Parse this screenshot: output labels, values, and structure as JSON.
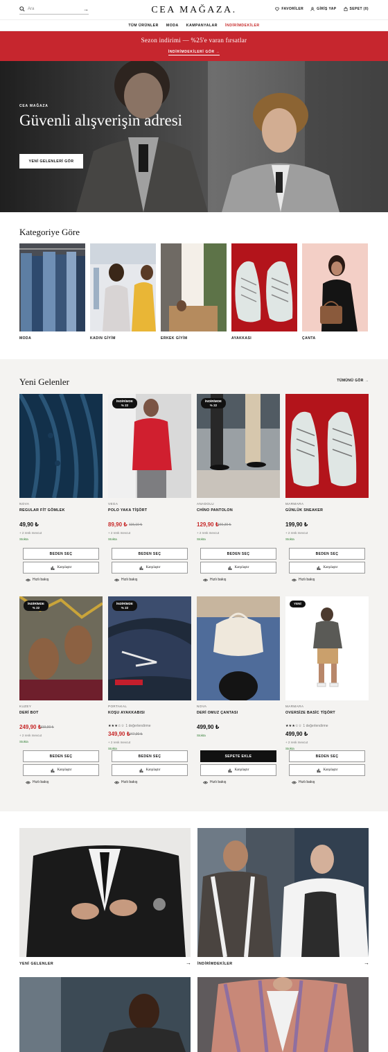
{
  "header": {
    "search_placeholder": "Ara",
    "logo": "CEA MAĞAZA.",
    "favorites": "FAVORİLER",
    "login": "GİRİŞ YAP",
    "cart": "SEPET (0)"
  },
  "nav": [
    "TÜM ÜRÜNLER",
    "MODA",
    "KAMPANYALAR",
    "İNDİRİMDEKİLER"
  ],
  "banner": {
    "text": "Sezon indirimi — %25'e varan fırsatlar",
    "link": "İNDİRİMDEKİLERİ GÖR →"
  },
  "hero": {
    "eyebrow": "CEA MAĞAZA",
    "title": "Güvenli alışverişin adresi",
    "button": "YENİ GELENLERİ GÖR"
  },
  "categories": {
    "title": "Kategoriye Göre",
    "items": [
      "MODA",
      "KADIN GİYİM",
      "ERKEK GİYİM",
      "AYAKKASI",
      "ÇANTA"
    ]
  },
  "new_arrivals": {
    "title": "Yeni Gelenler",
    "see_all": "TÜMÜNÜ GÖR →",
    "size_button": "BEDEN SEÇ",
    "add_to_cart": "SEPETE EKLE",
    "compare": "Karşılaştır",
    "quick_view": "Hızlı bakış",
    "products": [
      {
        "brand": "NOVA",
        "name": "REGULAR FİT GÖMLEK",
        "price": "49,90 ₺",
        "old_price": "",
        "colors": "+ 2 renk mevcut",
        "stock": "Stokta",
        "badge": "",
        "rating_text": ""
      },
      {
        "brand": "VEGA",
        "name": "POLO YAKA TİŞÖRT",
        "price": "89,90 ₺",
        "old_price": "115,10 ₺",
        "colors": "+ 2 renk mevcut",
        "stock": "Stokta",
        "badge": "İNDİRİMDE\n% 22",
        "rating_text": ""
      },
      {
        "brand": "ANADOLU",
        "name": "CHİNO PANTOLON",
        "price": "129,90 ₺",
        "old_price": "166,30 ₺",
        "colors": "+ 2 renk mevcut",
        "stock": "Stokta",
        "badge": "İNDİRİMDE\n% 22",
        "rating_text": ""
      },
      {
        "brand": "MARMARA",
        "name": "GÜNLÜK SNEAKER",
        "price": "199,90 ₺",
        "old_price": "",
        "colors": "+ 2 renk mevcut",
        "stock": "Stokta",
        "badge": "",
        "rating_text": ""
      },
      {
        "brand": "KUZEY",
        "name": "DERİ BOT",
        "price": "249,90 ₺",
        "old_price": "319,90 ₺",
        "colors": "+ 2 renk mevcut",
        "stock": "Stokta",
        "badge": "İNDİRİMDE\n% 22",
        "rating_text": ""
      },
      {
        "brand": "PORTAKAL",
        "name": "KOŞU AYAKKABISI",
        "price": "349,90 ₺",
        "old_price": "447,90 ₺",
        "colors": "+ 2 renk mevcut",
        "stock": "Stokta",
        "badge": "İNDİRİMDE\n% 22",
        "rating_text": "1 değerlendirme",
        "rating": 3
      },
      {
        "brand": "NOVA",
        "name": "DERİ OMUZ ÇANTASI",
        "price": "499,90 ₺",
        "old_price": "",
        "colors": "",
        "stock": "Stokta",
        "badge": "",
        "rating_text": ""
      },
      {
        "brand": "MARMARA",
        "name": "OVERSİZE BASİC TİŞÖRT",
        "price": "499,90 ₺",
        "old_price": "",
        "colors": "+ 2 renk mevcut",
        "stock": "Stokta",
        "badge": "YENİ",
        "rating_text": "1 değerlendirme",
        "rating": 3
      }
    ]
  },
  "promos": [
    "YENİ GELENLER",
    "İNDİRİMDEKİLER"
  ],
  "colors": {
    "accent_red": "#c6262e",
    "sale_red": "#c62828",
    "stock_green": "#2e7d32"
  }
}
